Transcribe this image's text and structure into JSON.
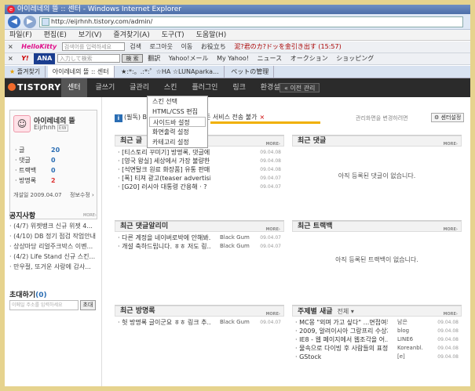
{
  "browser": {
    "title": "아이레네의 뜰 :: 센터 - Windows Internet Explorer",
    "url": "http://eijrhnh.tistory.com/admin/",
    "menu": [
      "파일(F)",
      "편집(E)",
      "보기(V)",
      "즐겨찾기(A)",
      "도구(T)",
      "도움말(H)"
    ],
    "toolbar1": {
      "brand": "HelloKitty",
      "search_placeholder": "검색어를 입력하세요",
      "items": [
        "검색",
        "로그아웃",
        "이동",
        "お役立ち",
        "泥?君のカ?ドッを金引き出す (15:57)"
      ]
    },
    "toolbar2": {
      "brand": "Y!",
      "ana": "ANA",
      "input_placeholder": "入力して検索",
      "search_btn": "検 索",
      "items": [
        "翻訳",
        "Yahoo!メール",
        "My Yahoo!",
        "ニュース",
        "オークション",
        "ショッピング"
      ]
    },
    "favorites_label": "즐겨찾기",
    "tabs": [
      "아이레네의 뜰 :: 센터",
      "★:*:。.:*:゜☆HA ☆LUNAparka...",
      "ペットの管理"
    ]
  },
  "tistory": {
    "logo": "TISTORY",
    "nav": [
      "센터",
      "글쓰기",
      "글관리",
      "스킨",
      "플러그인",
      "링크",
      "환경설정"
    ],
    "prev_mgmt": "이전 관리",
    "skin_menu": [
      "스킨 선택",
      "HTML/CSS 편집",
      "사이드바 설정",
      "화면출력 설정",
      "카테고리 설정"
    ]
  },
  "profile": {
    "blog_name": "아이레네의 뜰",
    "user_id": "Eijrhnh",
    "badge": "EW",
    "stats": [
      {
        "label": "· 글",
        "value": "20"
      },
      {
        "label": "· 댓글",
        "value": "0"
      },
      {
        "label": "· 트랙백",
        "value": "0"
      },
      {
        "label": "· 방명록",
        "value": "2"
      }
    ],
    "opened": "개설일 2009.04.07",
    "info_link": "정보수정"
  },
  "notice_box": {
    "title": "공지사항",
    "items": [
      "· (4/7) 위젯뱅크 신규 위젯 4...",
      "· (4/10) DB 정기 점검 작업안내",
      "· 상상마당 리얼주크박스 이벤...",
      "· (4/2) Life Stand 신규 스킨...",
      "· 만우절, 또거운 사랑에 감사..."
    ]
  },
  "invite": {
    "title": "초대하기",
    "count": "(0)",
    "placeholder": "이메일 주소를 입력하세요",
    "button": "초대"
  },
  "notice_banner": {
    "text": "(필독) Bl... 4월 4일 ~ 6일 모든 서비스 전송 불가",
    "manage_hint": "관리화면을 변경하려면",
    "settings_btn": "센터설정"
  },
  "panels": {
    "recent_posts": {
      "title": "최근 글",
      "rows": [
        {
          "t": "· [티스토리 꾸미기] 방명록, 댓글에...",
          "d": "09.04.08"
        },
        {
          "t": "· [영국 왕실] 세상에서 가장 불량한...",
          "d": "09.04.08"
        },
        {
          "t": "· [석면탈크 원료 화장품] 유통 판매...",
          "d": "09.04.08"
        },
        {
          "t": "· [폭] 티져 광고(teaser advertisin...",
          "d": "09.04.07"
        },
        {
          "t": "· [G20] 러시아 대통령 간용해 · ?",
          "d": "09.04.07"
        }
      ]
    },
    "recent_comments": {
      "title": "최근 댓글",
      "empty": "아직 등록된 댓글이 없습니다."
    },
    "recent_reply": {
      "title": "최근 댓글알리미",
      "rows": [
        {
          "t": "· 다른 계정을 네이버로박에 안해봐...",
          "a": "Black Gum",
          "d": "09.04.07"
        },
        {
          "t": "· 개설 축하드립니다. ㅎㅎ 저도 링...",
          "a": "Black Gum",
          "d": "09.04.07"
        }
      ]
    },
    "recent_trackback": {
      "title": "최근 트랙백",
      "empty": "아직 등록된 트랙백이 없습니다."
    },
    "recent_guestbook": {
      "title": "최근 방명록",
      "rows": [
        {
          "t": "· 헛 방명록 글이군요 ㅎㅎ 링크 추...",
          "a": "Black Gum",
          "d": "09.04.07"
        }
      ]
    },
    "topic_posts": {
      "title": "주제별 새글",
      "select": "전체",
      "rows": [
        {
          "t": "· MC몽 \"외며 가고 싶다\" ...면접여부...",
          "a": "남은",
          "d": "09.04.08"
        },
        {
          "t": "· 2009, 알려이시아 그랑프리 수상자...",
          "a": "blog",
          "d": "09.04.08"
        },
        {
          "t": "· IE8 - 웹 페이지에서 웹조각을 어...",
          "a": "LINE6",
          "d": "09.04.08"
        },
        {
          "t": "· 물속으로 다이빙 후 사람들의 표정...",
          "a": "Koreanbl.",
          "d": "09.04.08"
        },
        {
          "t": "· GStock",
          "a": "[e]",
          "d": "09.04.08"
        }
      ]
    }
  }
}
